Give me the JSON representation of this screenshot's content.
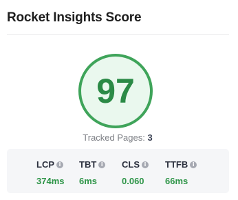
{
  "card": {
    "title": "Rocket Insights Score"
  },
  "score": {
    "value": "97",
    "color": "#2b8a46",
    "ring_color": "#3fa45a",
    "fill_color": "#eaf8ee"
  },
  "tracked": {
    "label": "Tracked Pages: ",
    "count": "3"
  },
  "metrics": [
    {
      "name": "LCP",
      "value": "374ms",
      "icon": "info-icon"
    },
    {
      "name": "TBT",
      "value": "6ms",
      "icon": "info-icon"
    },
    {
      "name": "CLS",
      "value": "0.060",
      "icon": "info-icon"
    },
    {
      "name": "TTFB",
      "value": "66ms",
      "icon": "info-icon"
    }
  ],
  "info_icon_glyph": "i"
}
